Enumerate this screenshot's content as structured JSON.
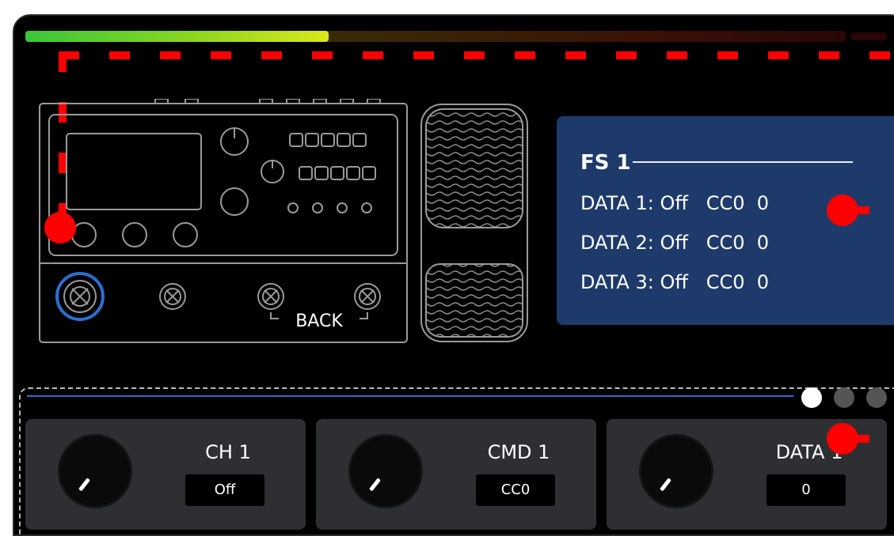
{
  "meter": {
    "level": 0.37
  },
  "device": {
    "back_label": "BACK"
  },
  "fs_panel": {
    "title": "FS 1",
    "rows": [
      {
        "label": "DATA 1: Off   CC0  0"
      },
      {
        "label": "DATA 2: Off   CC0  0"
      },
      {
        "label": "DATA 3: Off   CC0  0"
      }
    ]
  },
  "pager": {
    "active_index": 0,
    "count": 3
  },
  "cards": [
    {
      "label": "CH 1",
      "value": "Off"
    },
    {
      "label": "CMD 1",
      "value": "CC0"
    },
    {
      "label": "DATA 1",
      "value": "0"
    }
  ],
  "colors": {
    "accent": "#2c6fd1",
    "marker": "#ff0000",
    "panel": "#1e3a6b"
  }
}
